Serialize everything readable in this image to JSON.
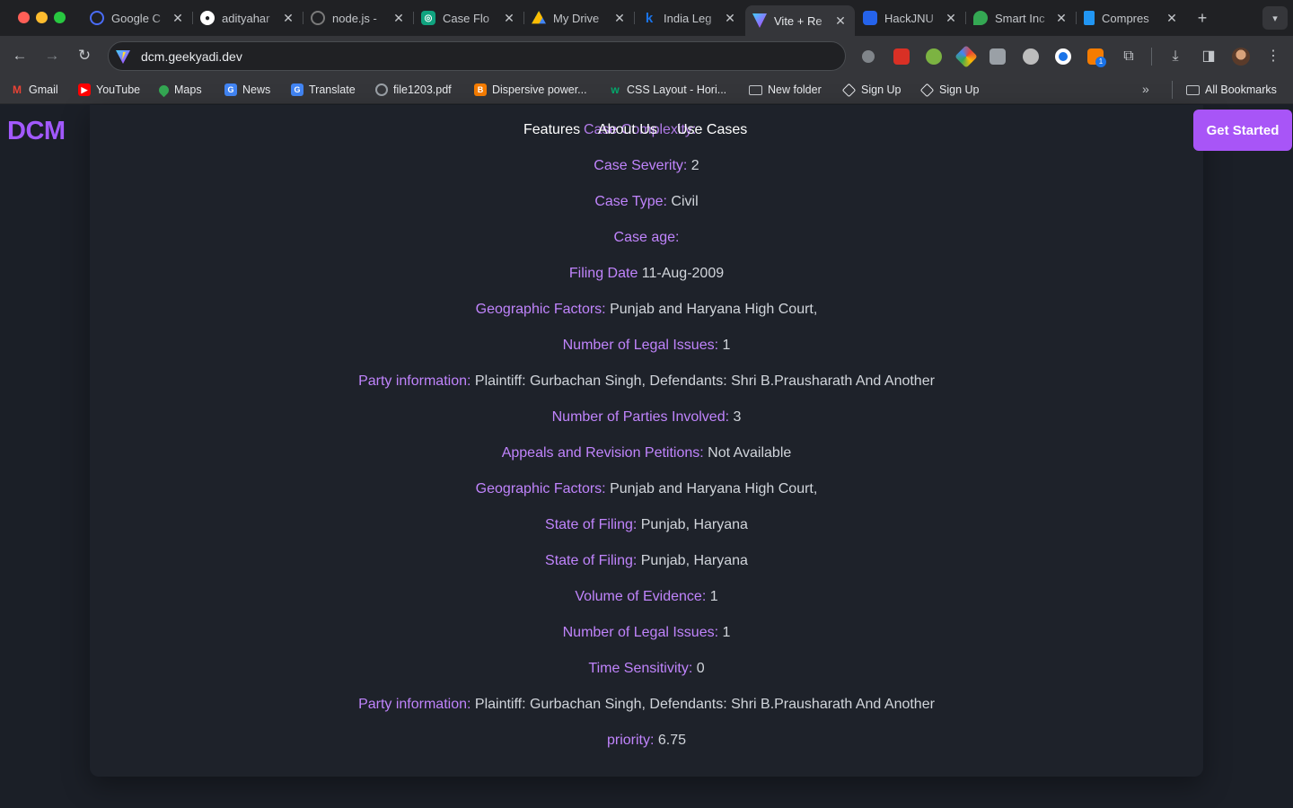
{
  "browser": {
    "tabs": [
      {
        "label": "Google C",
        "icon": "chrome-icon",
        "color": "#4a6cf7"
      },
      {
        "label": "adityahar",
        "icon": "github-icon",
        "color": "#ffffff"
      },
      {
        "label": "node.js -",
        "icon": "stackoverflow-icon",
        "color": "#7a7a7a"
      },
      {
        "label": "Case Flo",
        "icon": "chatgpt-icon",
        "color": "#10a37f"
      },
      {
        "label": "My Drive",
        "icon": "google-drive-icon",
        "color": "#fbbc04"
      },
      {
        "label": "India Leg",
        "icon": "kanoon-icon",
        "color": "#1a73e8"
      },
      {
        "label": "Vite + Re",
        "icon": "vite-icon",
        "color": "#a855f7"
      },
      {
        "label": "HackJNU",
        "icon": "hackjnu-icon",
        "color": "#2563eb"
      },
      {
        "label": "Smart Inc",
        "icon": "map-pin-icon",
        "color": "#34a853"
      },
      {
        "label": "Compres",
        "icon": "docs-icon",
        "color": "#2196f3"
      }
    ],
    "active_tab": 6,
    "url": "dcm.geekyadi.dev",
    "extension_badge": "1",
    "bookmarks": [
      {
        "label": "Gmail",
        "icon": "gmail-icon",
        "color": "#ea4335"
      },
      {
        "label": "YouTube",
        "icon": "youtube-icon",
        "color": "#ff0000"
      },
      {
        "label": "Maps",
        "icon": "maps-icon",
        "color": "#34a853"
      },
      {
        "label": "News",
        "icon": "news-icon",
        "color": "#4285f4"
      },
      {
        "label": "Translate",
        "icon": "translate-icon",
        "color": "#4285f4"
      },
      {
        "label": "file1203.pdf",
        "icon": "globe-icon",
        "color": "#9aa0a6"
      },
      {
        "label": "Dispersive power...",
        "icon": "blogger-icon",
        "color": "#f57c00"
      },
      {
        "label": "CSS Layout - Hori...",
        "icon": "w3schools-icon",
        "color": "#04aa6d"
      },
      {
        "label": "New folder",
        "icon": "folder-icon",
        "color": "#9aa0a6"
      },
      {
        "label": "Sign Up",
        "icon": "codepen-icon",
        "color": "#e8eaed"
      },
      {
        "label": "Sign Up",
        "icon": "codepen-icon",
        "color": "#e8eaed"
      }
    ],
    "all_bookmarks": "All Bookmarks"
  },
  "site": {
    "logo": "DCM",
    "nav": [
      "Features",
      "About Us",
      "Use Cases"
    ],
    "overlapping_title": "Case Complexity:",
    "cta": "Get Started"
  },
  "case_details": [
    {
      "key": "Case Severity:",
      "value": " 2"
    },
    {
      "key": "Case Type:",
      "value": " Civil"
    },
    {
      "key": "Case age:",
      "value": ""
    },
    {
      "key": "Filing Date",
      "value": " 11-Aug-2009"
    },
    {
      "key": "Geographic Factors:",
      "value": " Punjab and Haryana High Court,"
    },
    {
      "key": "Number of Legal Issues:",
      "value": " 1"
    },
    {
      "key": "Party information:",
      "value": " Plaintiff: Gurbachan Singh, Defendants: Shri B.Prausharath And Another"
    },
    {
      "key": "Number of Parties Involved:",
      "value": " 3"
    },
    {
      "key": "Appeals and Revision Petitions:",
      "value": " Not Available"
    },
    {
      "key": "Geographic Factors:",
      "value": " Punjab and Haryana High Court,"
    },
    {
      "key": "State of Filing:",
      "value": " Punjab, Haryana"
    },
    {
      "key": "State of Filing:",
      "value": " Punjab, Haryana"
    },
    {
      "key": "Volume of Evidence:",
      "value": " 1"
    },
    {
      "key": "Number of Legal Issues:",
      "value": " 1"
    },
    {
      "key": "Time Sensitivity:",
      "value": " 0"
    },
    {
      "key": "Party information:",
      "value": " Plaintiff: Gurbachan Singh, Defendants: Shri B.Prausharath And Another"
    },
    {
      "key": "priority:",
      "value": " 6.75"
    }
  ],
  "colors": {
    "accent": "#a855f7",
    "label": "#c084fc",
    "value": "#d1d5db",
    "background": "#1b1f27"
  }
}
